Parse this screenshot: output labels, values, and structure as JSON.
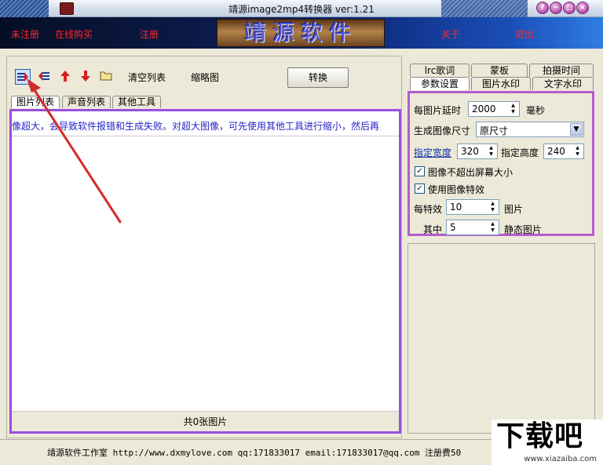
{
  "window": {
    "title": "靖源image2mp4转换器 ver:1.21",
    "buttons": [
      "?",
      "−",
      "□",
      "×"
    ]
  },
  "banner": {
    "unregistered": "未注册",
    "buy_online": "在线购买",
    "register": "注册",
    "logo_text": "靖源软件",
    "about": "关于",
    "exit": "退出"
  },
  "toolbar": {
    "icons": [
      "add-images-icon",
      "remove-icon",
      "move-up-icon",
      "move-down-icon",
      "open-folder-icon"
    ],
    "clear_list": "清空列表",
    "thumbnail": "缩略图",
    "convert": "转换"
  },
  "left_tabs": [
    "图片列表",
    "声音列表",
    "其他工具"
  ],
  "list": {
    "marquee": "像超大，会导致软件报错和生成失败。对超大图像，可先使用其他工具进行缩小，然后再",
    "footer": "共0张图片"
  },
  "right_tabs_row1": [
    "lrc歌词",
    "蒙板",
    "拍摄时间"
  ],
  "right_tabs_row2": [
    "参数设置",
    "图片水印",
    "文字水印"
  ],
  "settings": {
    "delay_label": "每图片延时",
    "delay_value": "2000",
    "delay_unit": "毫秒",
    "size_label": "生成图像尺寸",
    "size_value": "原尺寸",
    "width_label": "指定宽度",
    "width_value": "320",
    "height_label": "指定高度",
    "height_value": "240",
    "no_exceed_label": "图像不超出屏幕大小",
    "no_exceed_checked": true,
    "effects_label": "使用图像特效",
    "effects_checked": true,
    "per_effect_label": "每特效",
    "per_effect_value": "10",
    "per_effect_unit": "图片",
    "among_label": "其中",
    "among_value": "5",
    "among_unit": "静态图片"
  },
  "status": {
    "text": "靖源软件工作室 http://www.dxmylove.com qq:171833017 email:171833017@qq.com 注册费50"
  },
  "watermark": {
    "big": "下载吧",
    "small": "www.xiazaiba.com"
  }
}
